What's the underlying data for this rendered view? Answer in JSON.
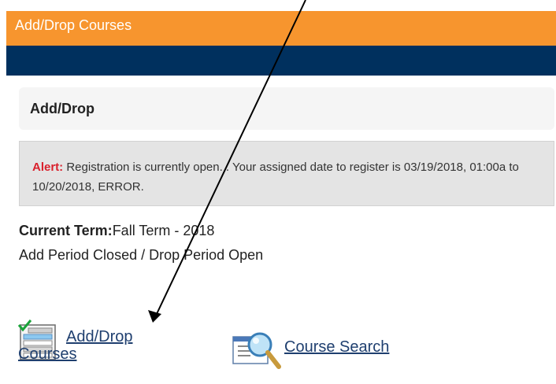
{
  "header": {
    "title": "Add/Drop Courses"
  },
  "section": {
    "title": "Add/Drop"
  },
  "alert": {
    "label": "Alert:",
    "message": " Registration is currently open. . Your assigned date to register is 03/19/2018, 01:00a to 10/20/2018, ERROR."
  },
  "term": {
    "label": "Current Term:",
    "value": "Fall Term - 2018"
  },
  "period_status": "Add Period Closed / Drop Period Open",
  "links": {
    "add_drop_line1": "Add/Drop",
    "add_drop_line2": "Courses",
    "course_search": "Course Search"
  },
  "icons": {
    "add_drop": "checklist-icon",
    "course_search": "magnifier-icon"
  },
  "colors": {
    "header_bg": "#f7952e",
    "nav_bg": "#00305e",
    "alert_label": "#d9202c",
    "link": "#1f3f6f"
  }
}
